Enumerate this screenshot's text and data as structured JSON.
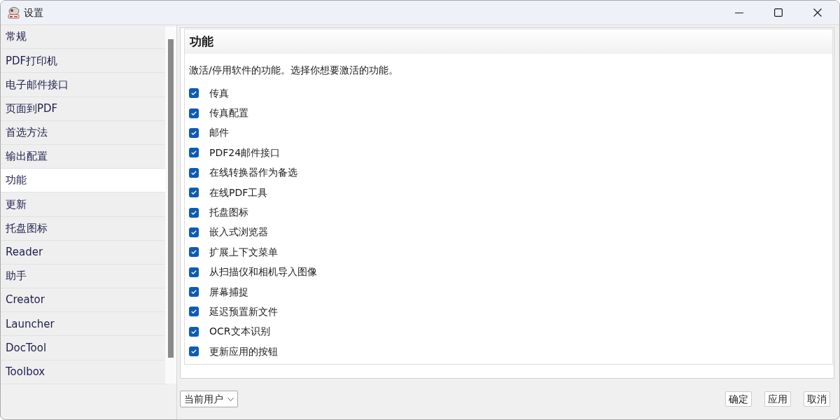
{
  "window": {
    "title": "设置"
  },
  "sidebar": {
    "items": [
      {
        "label": "常规",
        "selected": false
      },
      {
        "label": "PDF打印机",
        "selected": false
      },
      {
        "label": "电子邮件接口",
        "selected": false
      },
      {
        "label": "页面到PDF",
        "selected": false
      },
      {
        "label": "首选方法",
        "selected": false
      },
      {
        "label": "输出配置",
        "selected": false
      },
      {
        "label": "功能",
        "selected": true
      },
      {
        "label": "更新",
        "selected": false
      },
      {
        "label": "托盘图标",
        "selected": false
      },
      {
        "label": "Reader",
        "selected": false
      },
      {
        "label": "助手",
        "selected": false
      },
      {
        "label": "Creator",
        "selected": false
      },
      {
        "label": "Launcher",
        "selected": false
      },
      {
        "label": "DocTool",
        "selected": false
      },
      {
        "label": "Toolbox",
        "selected": false
      }
    ]
  },
  "panel": {
    "heading": "功能",
    "description": "激活/停用软件的功能。选择你想要激活的功能。",
    "options": [
      {
        "label": "传真",
        "checked": true
      },
      {
        "label": "传真配置",
        "checked": true
      },
      {
        "label": "邮件",
        "checked": true
      },
      {
        "label": "PDF24邮件接口",
        "checked": true
      },
      {
        "label": "在线转换器作为备选",
        "checked": true
      },
      {
        "label": "在线PDF工具",
        "checked": true
      },
      {
        "label": "托盘图标",
        "checked": true
      },
      {
        "label": "嵌入式浏览器",
        "checked": true
      },
      {
        "label": "扩展上下文菜单",
        "checked": true
      },
      {
        "label": "从扫描仪和相机导入图像",
        "checked": true
      },
      {
        "label": "屏幕捕捉",
        "checked": true
      },
      {
        "label": "延迟预置新文件",
        "checked": true
      },
      {
        "label": "OCR文本识别",
        "checked": true
      },
      {
        "label": "更新应用的按钮",
        "checked": true
      }
    ]
  },
  "footer": {
    "scope_dropdown": {
      "value": "当前用户"
    },
    "buttons": [
      "确定",
      "应用",
      "取消"
    ]
  }
}
